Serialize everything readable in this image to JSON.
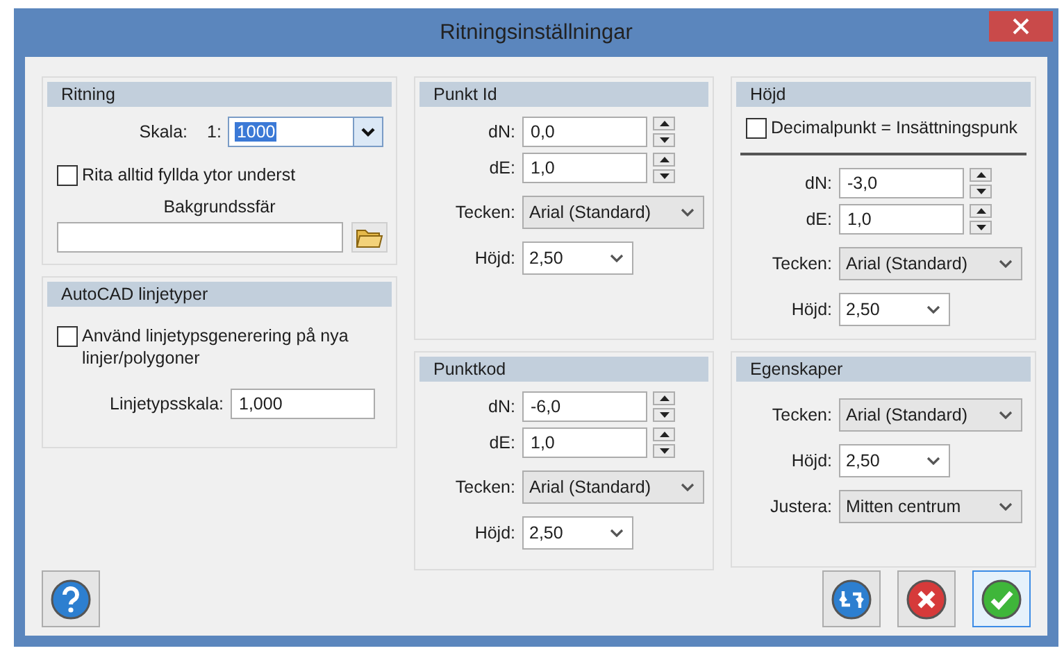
{
  "window": {
    "title": "Ritningsinställningar"
  },
  "columns": [
    [
      {
        "title": "Ritning",
        "rows": [
          {
            "kind": "scale",
            "label": "Skala:",
            "prefix": "1:",
            "value": "1000",
            "text_selected": true
          },
          {
            "kind": "check",
            "label": "Rita alltid fyllda ytor underst",
            "checked": false
          },
          {
            "kind": "color",
            "label": "Bakgrundssfär",
            "value": ""
          }
        ]
      },
      {
        "title": "AutoCAD linjetyper",
        "rows": [
          {
            "kind": "check",
            "label": "Använd linjetypsgenerering på nya linjer/polygoner",
            "checked": false
          },
          {
            "kind": "text",
            "label": "Linjetypsskala:",
            "value": "1,000"
          }
        ]
      }
    ],
    [
      {
        "title": "Punkt Id",
        "rows": [
          {
            "kind": "spin",
            "label": "dN:",
            "value": "0,0"
          },
          {
            "kind": "spin",
            "label": "dE:",
            "value": "1,0"
          },
          {
            "kind": "select",
            "label": "Tecken:",
            "value": "Arial (Standard)"
          },
          {
            "kind": "combo",
            "label": "Höjd:",
            "value": "2,50"
          }
        ]
      },
      {
        "title": "Punktkod",
        "rows": [
          {
            "kind": "spin",
            "label": "dN:",
            "value": "-6,0"
          },
          {
            "kind": "spin",
            "label": "dE:",
            "value": "1,0"
          },
          {
            "kind": "select",
            "label": "Tecken:",
            "value": "Arial (Standard)"
          },
          {
            "kind": "combo",
            "label": "Höjd:",
            "value": "2,50"
          }
        ]
      }
    ],
    [
      {
        "title": "Höjd",
        "rows": [
          {
            "kind": "check",
            "label": "Decimalpunkt = Insättningspunk",
            "checked": false
          },
          {
            "kind": "separator"
          },
          {
            "kind": "spin",
            "label": "dN:",
            "value": "-3,0"
          },
          {
            "kind": "spin",
            "label": "dE:",
            "value": "1,0"
          },
          {
            "kind": "select",
            "label": "Tecken:",
            "value": "Arial (Standard)"
          },
          {
            "kind": "combo",
            "label": "Höjd:",
            "value": "2,50"
          }
        ]
      },
      {
        "title": "Egenskaper",
        "rows": [
          {
            "kind": "select",
            "label": "Tecken:",
            "value": "Arial (Standard)"
          },
          {
            "kind": "combo",
            "label": "Höjd:",
            "value": "2,50"
          },
          {
            "kind": "select",
            "label": "Justera:",
            "value": "Mitten centrum"
          }
        ]
      }
    ]
  ],
  "buttons": [
    {
      "kind": "help",
      "focused": false
    },
    {
      "kind": "reset",
      "focused": false
    },
    {
      "kind": "cancel",
      "focused": false
    },
    {
      "kind": "ok",
      "focused": true
    }
  ]
}
